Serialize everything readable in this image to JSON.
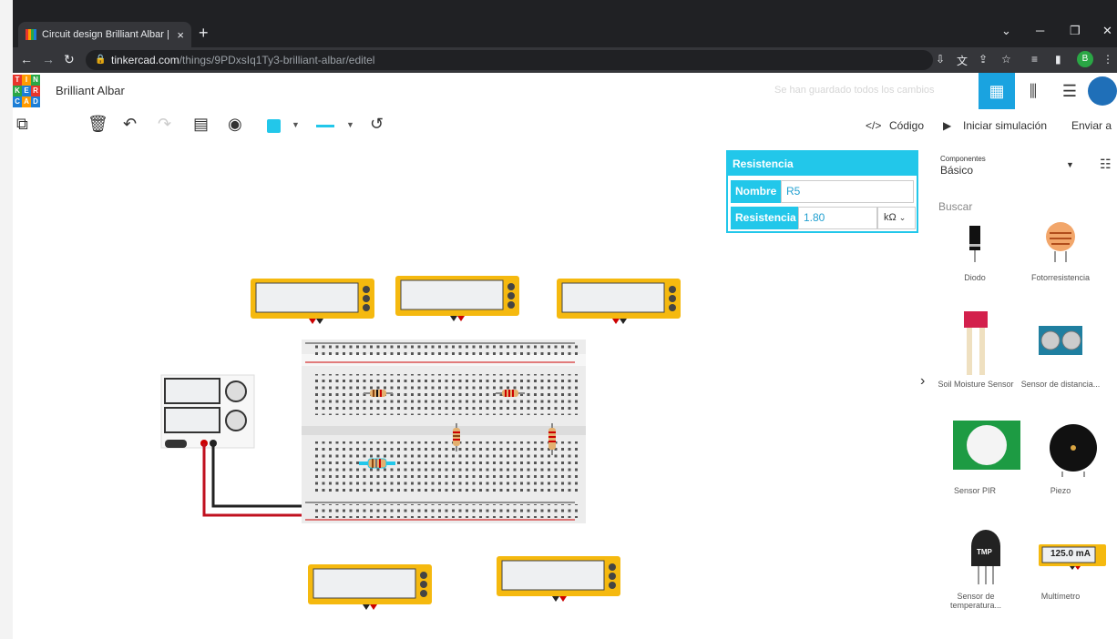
{
  "browser": {
    "tab_title": "Circuit design Brilliant Albar | Tin",
    "tab_close": "×",
    "new_tab": "+",
    "url_host": "tinkercad.com",
    "url_path": "/things/9PDxsIq1Ty3-brilliant-albar/editel",
    "profile_initial": "B"
  },
  "app": {
    "logo_letters": [
      "T",
      "I",
      "N",
      "K",
      "E",
      "R",
      "C",
      "A",
      "D"
    ],
    "project_name": "Brilliant Albar",
    "saved_status": "Se han guardado todos los cambios",
    "code_label": "Código",
    "simulate_label": "Iniciar simulación",
    "send_label": "Enviar a"
  },
  "inspector": {
    "title": "Resistencia",
    "name_label": "Nombre",
    "name_value": "R5",
    "resistance_label": "Resistencia",
    "resistance_value": "1.80",
    "unit": "kΩ"
  },
  "panel": {
    "components_small": "Componentes",
    "components_selected": "Básico",
    "search_label": "Buscar",
    "items": [
      {
        "label": "Diodo"
      },
      {
        "label": "Fotorresistencia"
      },
      {
        "label": "Soil Moisture Sensor"
      },
      {
        "label": "Sensor de distancia..."
      },
      {
        "label": "Sensor PIR"
      },
      {
        "label": "Piezo"
      },
      {
        "label": "Sensor de temperatura..."
      },
      {
        "label": "Multímetro"
      }
    ],
    "multimeter_reading": "125.0 mA",
    "tmp_chip_label": "TMP"
  },
  "colors": {
    "accent": "#22c7ea",
    "multimeter": "#f5b90f",
    "breadboard": "#ececec"
  }
}
